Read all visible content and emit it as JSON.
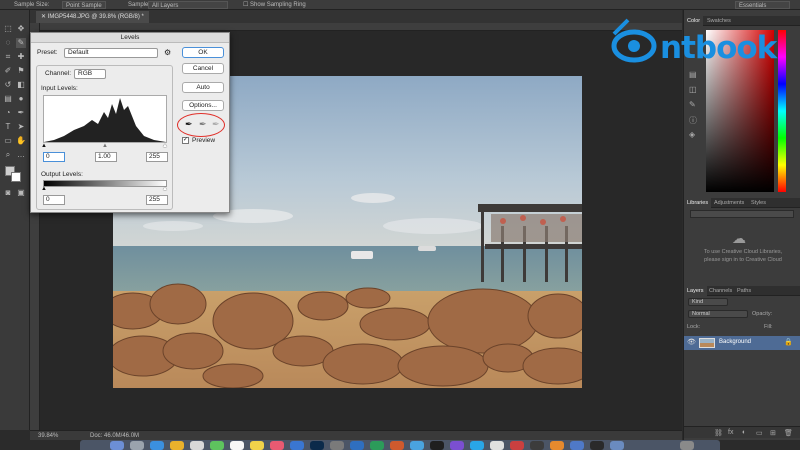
{
  "options_bar": {
    "sample_size_label": "Sample Size:",
    "sample_size_value": "Point Sample",
    "sample_label": "Sample:",
    "sample_value": "All Layers",
    "show_sampling_ring": "Show Sampling Ring",
    "workspace": "Essentials"
  },
  "document": {
    "tab_title": "IMGP5448.JPG @ 39.8% (RGB/8) *",
    "zoom": "39.84%",
    "doc_size": "Doc: 46.0M/46.0M"
  },
  "levels_dialog": {
    "title": "Levels",
    "preset_label": "Preset:",
    "preset_value": "Default",
    "channel_label": "Channel:",
    "channel_value": "RGB",
    "input_levels_label": "Input Levels:",
    "input_black": "0",
    "input_gamma": "1.00",
    "input_white": "255",
    "output_levels_label": "Output Levels:",
    "output_black": "0",
    "output_white": "255",
    "ok": "OK",
    "cancel": "Cancel",
    "auto": "Auto",
    "options": "Options...",
    "preview_label": "Preview",
    "preview_checked": true
  },
  "right_panel": {
    "color_tabs": [
      "Color",
      "Swatches"
    ],
    "libraries_tabs": [
      "Libraries",
      "Adjustments",
      "Styles"
    ],
    "libraries_message_1": "To use Creative Cloud Libraries,",
    "libraries_message_2": "please sign in to Creative Cloud",
    "layers_tabs": [
      "Layers",
      "Channels",
      "Paths"
    ],
    "kind_label": "Kind",
    "blend_mode": "Normal",
    "opacity_label": "Opacity:",
    "lock_label": "Lock:",
    "fill_label": "Fill:",
    "layer_name": "Background"
  },
  "watermark": {
    "brand": "ntbook",
    "color": "#1a8fe0"
  },
  "colors": {
    "accent": "#1a8fe0",
    "highlight_circle": "#e0302a"
  }
}
